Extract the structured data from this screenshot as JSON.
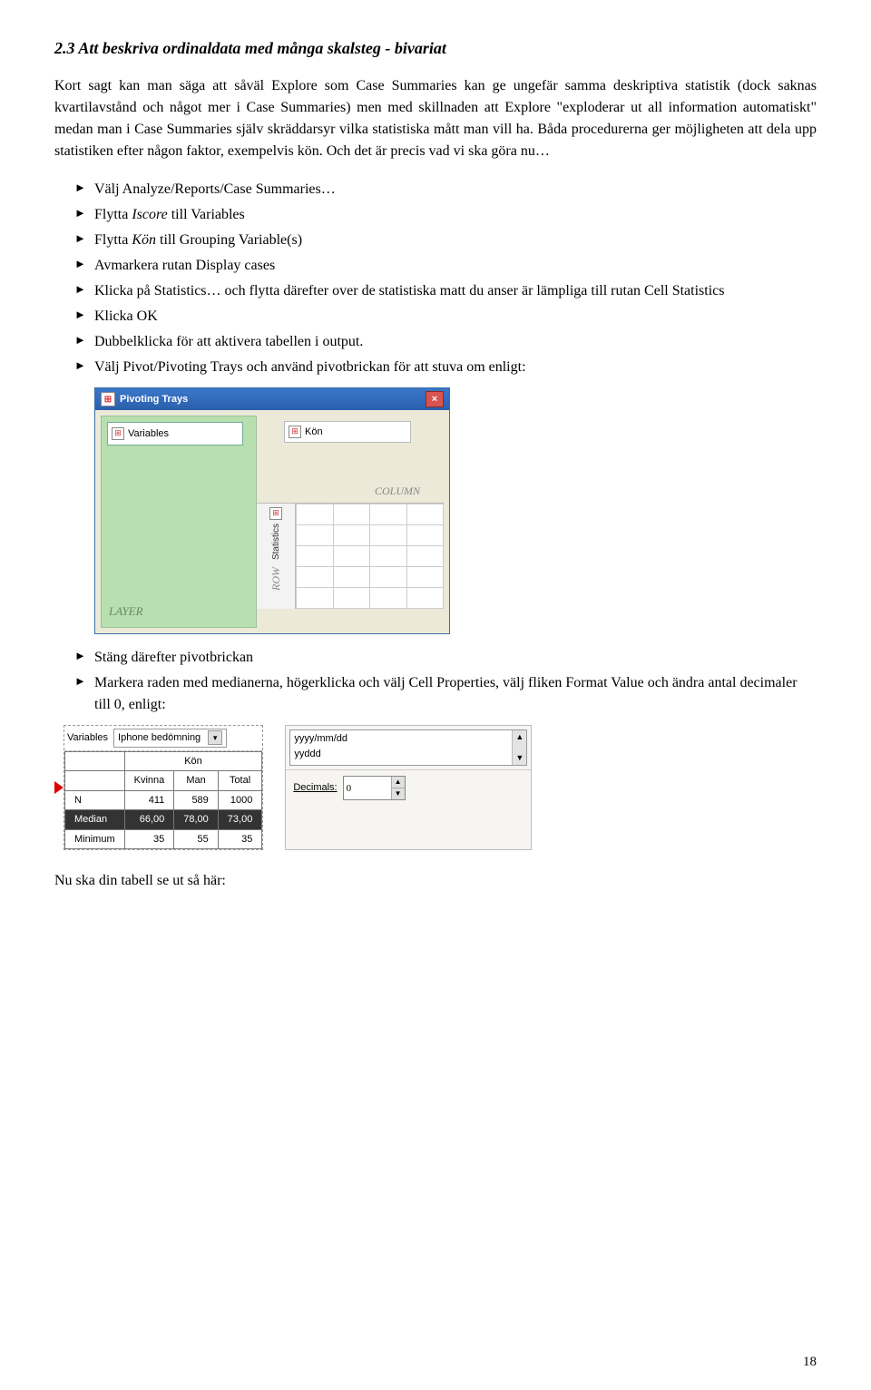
{
  "heading": "2.3 Att beskriva ordinaldata med många skalsteg - bivariat",
  "para1": "Kort sagt kan man säga att såväl Explore som Case Summaries kan ge ungefär samma deskriptiva statistik (dock saknas kvartilavstånd och något mer i Case Summaries) men med skillnaden att Explore \"exploderar ut all information automatiskt\" medan man i Case Summaries själv skräddarsyr vilka statistiska mått man vill ha. Båda procedurerna ger möjligheten att dela upp statistiken efter någon faktor, exempelvis kön. Och det är precis vad vi ska göra nu…",
  "steps": {
    "s1": "Välj Analyze/Reports/Case Summaries…",
    "s2a": "Flytta ",
    "s2b": "Iscore",
    "s2c": " till Variables",
    "s3a": "Flytta ",
    "s3b": "Kön",
    "s3c": " till Grouping Variable(s)",
    "s4": "Avmarkera rutan Display cases",
    "s5": "Klicka på Statistics… och flytta därefter over de statistiska matt du anser är lämpliga till rutan Cell Statistics",
    "s6": "Klicka OK",
    "s7": "Dubbelklicka för att aktivera tabellen i output.",
    "s8": "Välj Pivot/Pivoting Trays och använd pivotbrickan för att stuva om enligt:"
  },
  "pivot": {
    "title": "Pivoting Trays",
    "variables": "Variables",
    "kon": "Kön",
    "column": "COLUMN",
    "layer": "LAYER",
    "statistics": "Statistics",
    "row": "ROW"
  },
  "steps2": {
    "p1": "Stäng därefter pivotbrickan",
    "p2": "Markera raden med medianerna, högerklicka och välj Cell Properties, välj fliken Format Value och ändra antal decimaler till 0, enligt:"
  },
  "table": {
    "varlabel": "Variables",
    "dropdown": "Iphone bedömning",
    "header_kon": "Kön",
    "cols": [
      "Kvinna",
      "Man",
      "Total"
    ],
    "rows": [
      {
        "label": "N",
        "vals": [
          "411",
          "589",
          "1000"
        ]
      },
      {
        "label": "Median",
        "vals": [
          "66,00",
          "78,00",
          "73,00"
        ],
        "selected": true
      },
      {
        "label": "Minimum",
        "vals": [
          "35",
          "55",
          "35"
        ]
      }
    ]
  },
  "fmt": {
    "opt1": "yyyy/mm/dd",
    "opt2": "yyddd",
    "decimals_label": "Decimals:",
    "decimals_value": "0"
  },
  "footer": "Nu ska din tabell se ut så här:",
  "page": "18"
}
